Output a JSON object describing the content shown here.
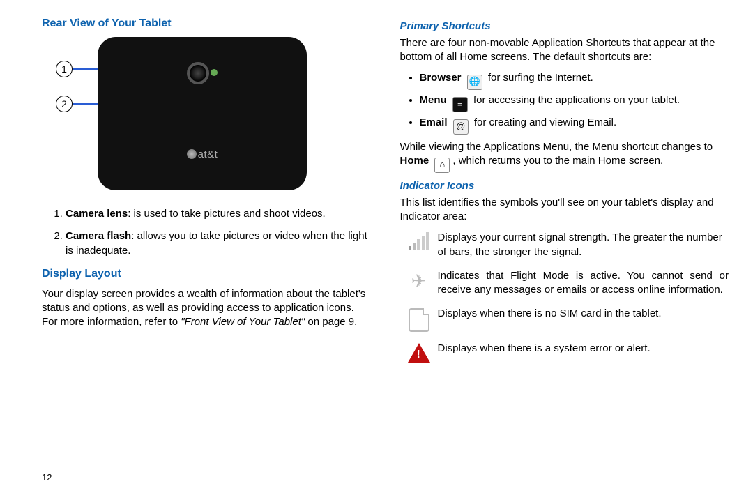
{
  "page_number": "12",
  "left": {
    "heading_rear": "Rear View of Your Tablet",
    "callouts": {
      "one": "1",
      "two": "2"
    },
    "brand": "at&t",
    "list": {
      "item1_bold": "Camera lens",
      "item1_rest": ": is used to take pictures and shoot videos.",
      "item2_bold": "Camera flash",
      "item2_rest": ": allows you to take pictures or video when the light is inadequate."
    },
    "heading_display": "Display Layout",
    "display_para_a": "Your display screen provides a wealth of information about the tablet's status and options, as well as providing access to application icons. For more information, refer to ",
    "display_ref": "\"Front View of Your Tablet\"",
    "display_para_b": " on page 9."
  },
  "right": {
    "heading_primary": "Primary Shortcuts",
    "primary_para": "There are four non-movable Application Shortcuts that appear at the bottom of all Home screens. The default shortcuts are:",
    "shortcuts": {
      "browser_b": "Browser",
      "browser_rest": " for surfing the Internet.",
      "menu_b": "Menu",
      "menu_rest": " for accessing the applications on your tablet.",
      "email_b": "Email",
      "email_rest": " for creating and viewing Email."
    },
    "primary_note_a": "While viewing the Applications Menu, the Menu shortcut changes to ",
    "primary_note_home": "Home",
    "primary_note_b": ", which returns you to the main Home screen.",
    "heading_indicator": "Indicator Icons",
    "indicator_intro": "This list identifies the symbols you'll see on your tablet's display and Indicator area:",
    "rows": {
      "signal": "Displays your current signal strength. The greater the number of bars, the stronger the signal.",
      "flight": "Indicates that Flight Mode is active. You cannot send or receive any messages or emails or access online information.",
      "sim": "Displays when there is no SIM card in the tablet.",
      "alert": "Displays when there is a system error or alert."
    }
  },
  "icons": {
    "browser_glyph": "🌐",
    "menu_glyph": "≡",
    "email_glyph": "@",
    "home_glyph": "⌂",
    "plane_glyph": "✈"
  }
}
